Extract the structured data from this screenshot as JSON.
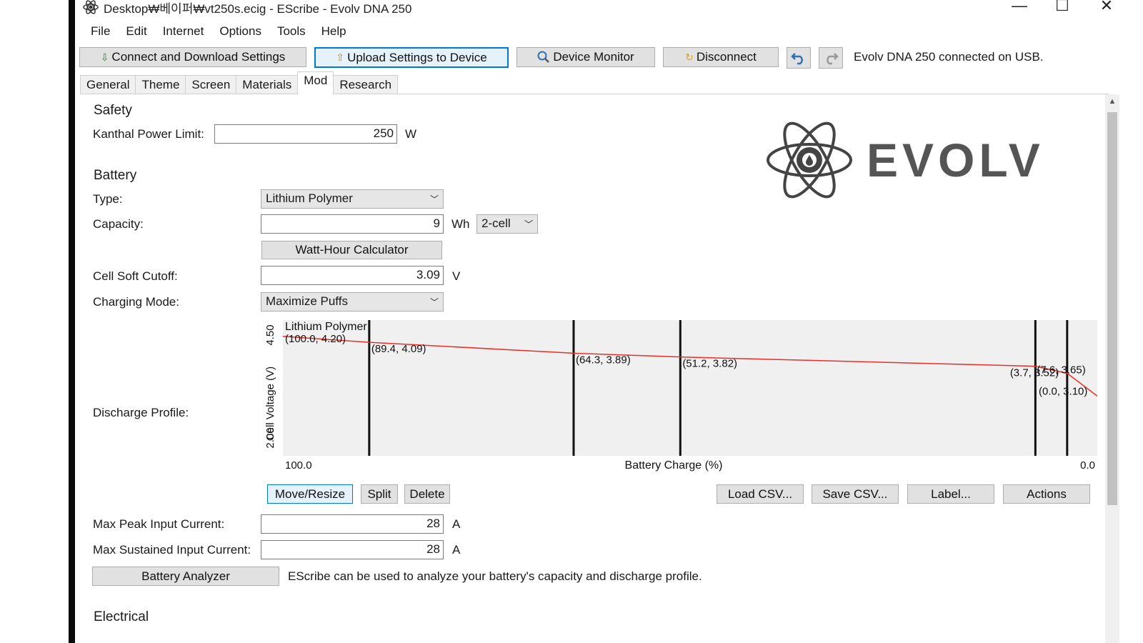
{
  "window": {
    "title": "Desktop₩베이퍼₩vt250s.ecig - EScribe - Evolv DNA 250",
    "minimize": "—",
    "maximize": "☐",
    "close": "✕"
  },
  "menu": [
    "File",
    "Edit",
    "Internet",
    "Options",
    "Tools",
    "Help"
  ],
  "toolbar": {
    "connect": "Connect and Download Settings",
    "upload": "Upload Settings to Device",
    "monitor": "Device Monitor",
    "disconnect": "Disconnect",
    "status": "Evolv DNA 250 connected on USB."
  },
  "tabs": [
    "General",
    "Theme",
    "Screen",
    "Materials",
    "Mod",
    "Research"
  ],
  "safety": {
    "heading": "Safety",
    "kanthal_label": "Kanthal Power Limit:",
    "kanthal_value": "250",
    "kanthal_unit": "W"
  },
  "battery": {
    "heading": "Battery",
    "type_label": "Type:",
    "type_value": "Lithium Polymer",
    "capacity_label": "Capacity:",
    "capacity_value": "9",
    "capacity_unit": "Wh",
    "cells_value": "2-cell",
    "watt_hour_calc": "Watt-Hour Calculator",
    "cutoff_label": "Cell Soft Cutoff:",
    "cutoff_value": "3.09",
    "cutoff_unit": "V",
    "charging_label": "Charging Mode:",
    "charging_value": "Maximize Puffs",
    "discharge_label": "Discharge Profile:",
    "move_resize": "Move/Resize",
    "split": "Split",
    "delete": "Delete",
    "load_csv": "Load CSV...",
    "save_csv": "Save CSV...",
    "label_btn": "Label...",
    "actions": "Actions",
    "peak_label": "Max Peak Input Current:",
    "peak_value": "28",
    "peak_unit": "A",
    "sustained_label": "Max Sustained Input Current:",
    "sustained_value": "28",
    "sustained_unit": "A",
    "analyzer": "Battery Analyzer",
    "analyzer_note": "EScribe can be used to analyze your battery's capacity and discharge profile."
  },
  "electrical": {
    "heading": "Electrical"
  },
  "logo_text": "EVOLV",
  "chart_data": {
    "type": "line",
    "title": "Lithium Polymer",
    "xlabel": "Battery Charge (%)",
    "ylabel": "Cell Voltage (V)",
    "xlim": [
      100.0,
      0.0
    ],
    "ylim": [
      2.0,
      4.5
    ],
    "x_tick_labels": [
      "100.0",
      "0.0"
    ],
    "y_tick_labels": [
      "2.00",
      "4.50"
    ],
    "series": [
      {
        "points": [
          {
            "x": 100.0,
            "y": 4.2,
            "label": "(100.0, 4.20)"
          },
          {
            "x": 89.4,
            "y": 4.09,
            "label": "(89.4, 4.09)"
          },
          {
            "x": 64.3,
            "y": 3.89,
            "label": "(64.3, 3.89)"
          },
          {
            "x": 51.2,
            "y": 3.82,
            "label": "(51.2, 3.82)"
          },
          {
            "x": 7.6,
            "y": 3.65,
            "label": "(7.6, 3.65)"
          },
          {
            "x": 3.7,
            "y": 3.52,
            "label": "(3.7, 3.52)"
          },
          {
            "x": 0.0,
            "y": 3.1,
            "label": "(0.0, 3.10)"
          }
        ]
      }
    ],
    "divider_x": [
      89.4,
      64.3,
      51.2,
      7.6,
      3.7
    ],
    "line_color": "#e8302a"
  }
}
